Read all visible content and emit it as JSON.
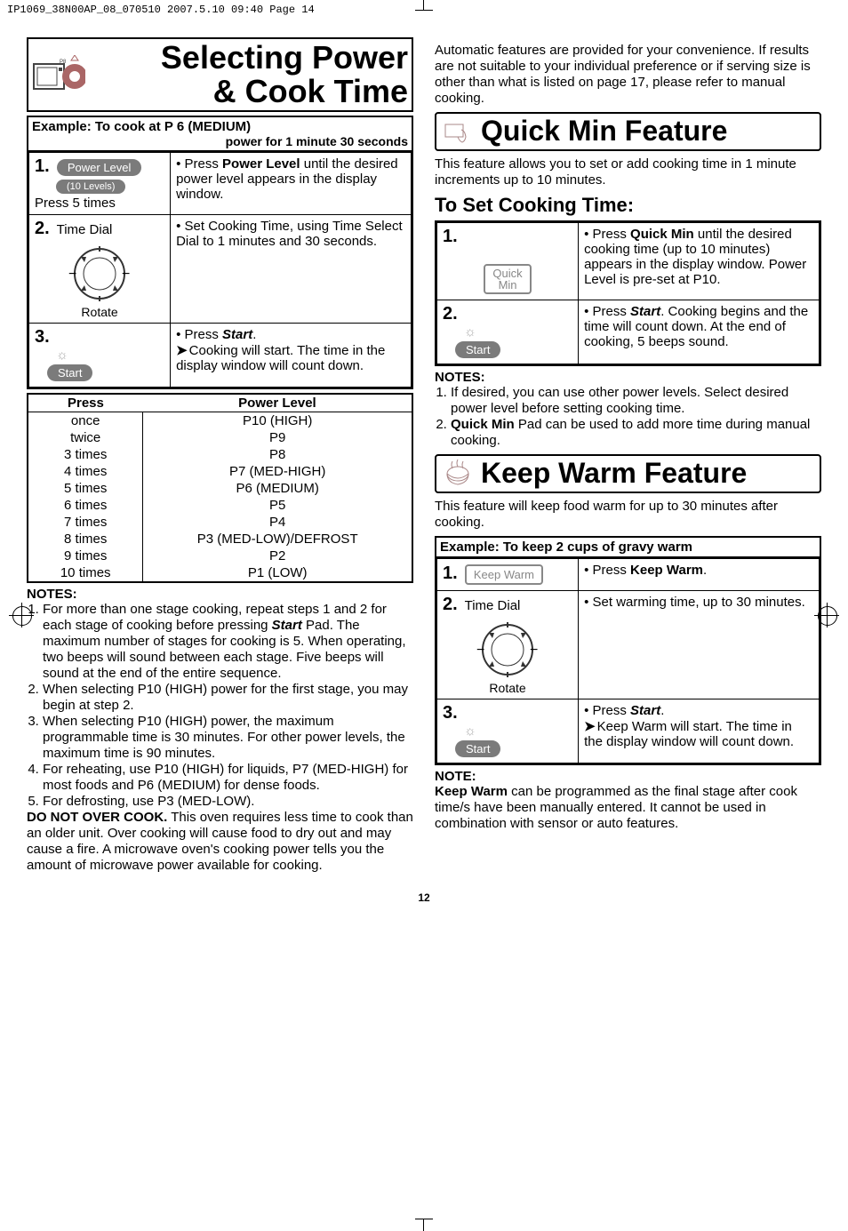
{
  "header_line": "IP1069_38N00AP_08_070510   2007.5.10   09:40   Page 14",
  "page_number": "12",
  "left": {
    "section_title_l1": "Selecting Power",
    "section_title_l2": "& Cook Time",
    "example_line1": "Example: To cook at P 6 (MEDIUM)",
    "example_line2": "power for 1 minute 30 seconds",
    "step1_num": "1.",
    "step1_label": "Press 5 times",
    "step1_pill1": "Power Level",
    "step1_pill2": "(10 Levels)",
    "step1_desc_prefix": "• Press ",
    "step1_desc_bold": "Power Level",
    "step1_desc_rest": " until the desired power level appears in the display window.",
    "step2_num": "2.",
    "step2_label": "Time Dial",
    "step2_rotate": "Rotate",
    "step2_desc": "• Set Cooking Time, using Time Select Dial to 1 minutes and 30 seconds.",
    "step3_num": "3.",
    "step3_pill": "Start",
    "step3_desc_l1_prefix": "• Press ",
    "step3_desc_l1_bold": "Start",
    "step3_desc_l1_suffix": ".",
    "step3_desc_l2": "Cooking will start. The time in the display window will count down.",
    "power_header_press": "Press",
    "power_header_level": "Power Level",
    "power_rows": [
      {
        "press": "once",
        "level": "P10 (HIGH)"
      },
      {
        "press": "twice",
        "level": "P9"
      },
      {
        "press": "3 times",
        "level": "P8"
      },
      {
        "press": "4 times",
        "level": "P7 (MED-HIGH)"
      },
      {
        "press": "5 times",
        "level": "P6 (MEDIUM)"
      },
      {
        "press": "6 times",
        "level": "P5"
      },
      {
        "press": "7 times",
        "level": "P4"
      },
      {
        "press": "8 times",
        "level": "P3 (MED-LOW)/DEFROST"
      },
      {
        "press": "9 times",
        "level": "P2"
      },
      {
        "press": "10 times",
        "level": "P1 (LOW)"
      }
    ],
    "notes_title": "NOTES:",
    "notes": [
      "For more than one stage cooking, repeat steps 1 and 2 for each stage of cooking before pressing Start Pad. The maximum number of stages for cooking is 5. When operating, two beeps will sound between each stage. Five beeps will sound at the end of the entire sequence.",
      "When selecting P10 (HIGH) power for the first stage, you may begin at step 2.",
      "When selecting P10 (HIGH) power, the maximum programmable time is 30 minutes. For other power levels, the maximum time is 90 minutes.",
      "For reheating, use P10 (HIGH) for liquids, P7 (MED-HIGH) for most foods and P6 (MEDIUM) for dense foods.",
      "For defrosting, use P3 (MED-LOW)."
    ],
    "warn_bold": "DO NOT OVER COOK.",
    "warn_rest": " This oven requires less time to cook than an older unit. Over cooking will cause food to dry out and may cause a fire. A microwave oven's cooking power tells you the amount of microwave power available for cooking."
  },
  "right": {
    "intro": "Automatic features are provided for your convenience. If results are not suitable to your individual preference or if serving size is other than what is listed on page 17, please refer to manual cooking.",
    "quick_title": "Quick Min Feature",
    "quick_intro": "This feature allows you to set or add cooking time in 1 minute increments up to 10 minutes.",
    "quick_subhead": "To Set Cooking Time:",
    "q_step1_num": "1.",
    "q_step1_pill_l1": "Quick",
    "q_step1_pill_l2": "Min",
    "q_step1_desc_prefix": "• Press ",
    "q_step1_desc_bold": "Quick Min",
    "q_step1_desc_rest": " until the desired cooking time (up to 10 minutes) appears in the display window. Power Level is pre-set at P10.",
    "q_step2_num": "2.",
    "q_step2_pill": "Start",
    "q_step2_desc_prefix": "• Press ",
    "q_step2_desc_bold": "Start",
    "q_step2_desc_suffix": ".",
    "q_step2_rest": " Cooking begins and the time will count down. At the end of cooking, 5 beeps sound.",
    "qnotes_title": "NOTES:",
    "qnotes": [
      "If desired, you can use other power levels. Select desired power level before setting cooking time.",
      "Quick Min Pad can be used to add more time during manual cooking."
    ],
    "keep_title": "Keep Warm Feature",
    "keep_intro": "This feature will keep food warm for up to 30 minutes after cooking.",
    "keep_example": "Example: To keep 2 cups of gravy warm",
    "k_step1_num": "1.",
    "k_step1_pill": "Keep Warm",
    "k_step1_desc_prefix": "• Press ",
    "k_step1_desc_bold": "Keep Warm",
    "k_step1_desc_suffix": ".",
    "k_step2_num": "2.",
    "k_step2_label": "Time Dial",
    "k_step2_rotate": "Rotate",
    "k_step2_desc": "• Set warming time, up to 30 minutes.",
    "k_step3_num": "3.",
    "k_step3_pill": "Start",
    "k_step3_desc_l1_prefix": "• Press ",
    "k_step3_desc_l1_bold": "Start",
    "k_step3_desc_l1_suffix": ".",
    "k_step3_desc_l2": "Keep Warm will start. The time in the display window will count down.",
    "note_title": "NOTE:",
    "note_bold": "Keep Warm",
    "note_rest": " can be programmed as the final stage after cook time/s have been manually entered. It cannot be used in combination with sensor or auto features."
  }
}
